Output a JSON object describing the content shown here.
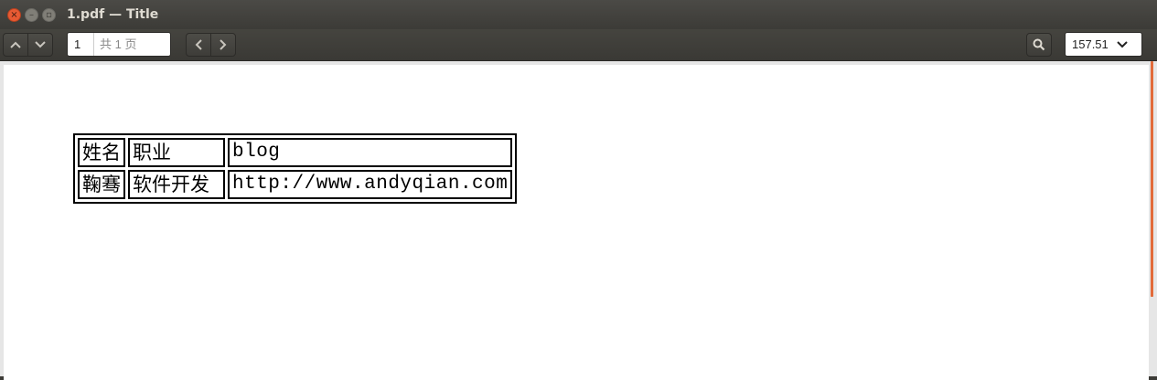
{
  "window": {
    "title": "1.pdf — Title"
  },
  "toolbar": {
    "page_input": "1",
    "page_total": "共 1 页",
    "zoom": "157.51"
  },
  "icons": {
    "close": "close-icon",
    "minimize": "minimize-icon",
    "maximize": "maximize-icon",
    "prev_page": "chevron-up-icon",
    "next_page": "chevron-down-icon",
    "back": "chevron-left-icon",
    "forward": "chevron-right-icon",
    "search": "search-icon",
    "zoom_dropdown": "chevron-down-icon"
  },
  "document": {
    "table": {
      "rows": [
        [
          "姓名",
          "职业",
          "blog"
        ],
        [
          "鞠骞",
          "软件开发",
          "http://www.andyqian.com"
        ]
      ]
    }
  },
  "colors": {
    "accent": "#e26b3a",
    "titlebar": "#3c3b37",
    "close": "#e75a33"
  }
}
